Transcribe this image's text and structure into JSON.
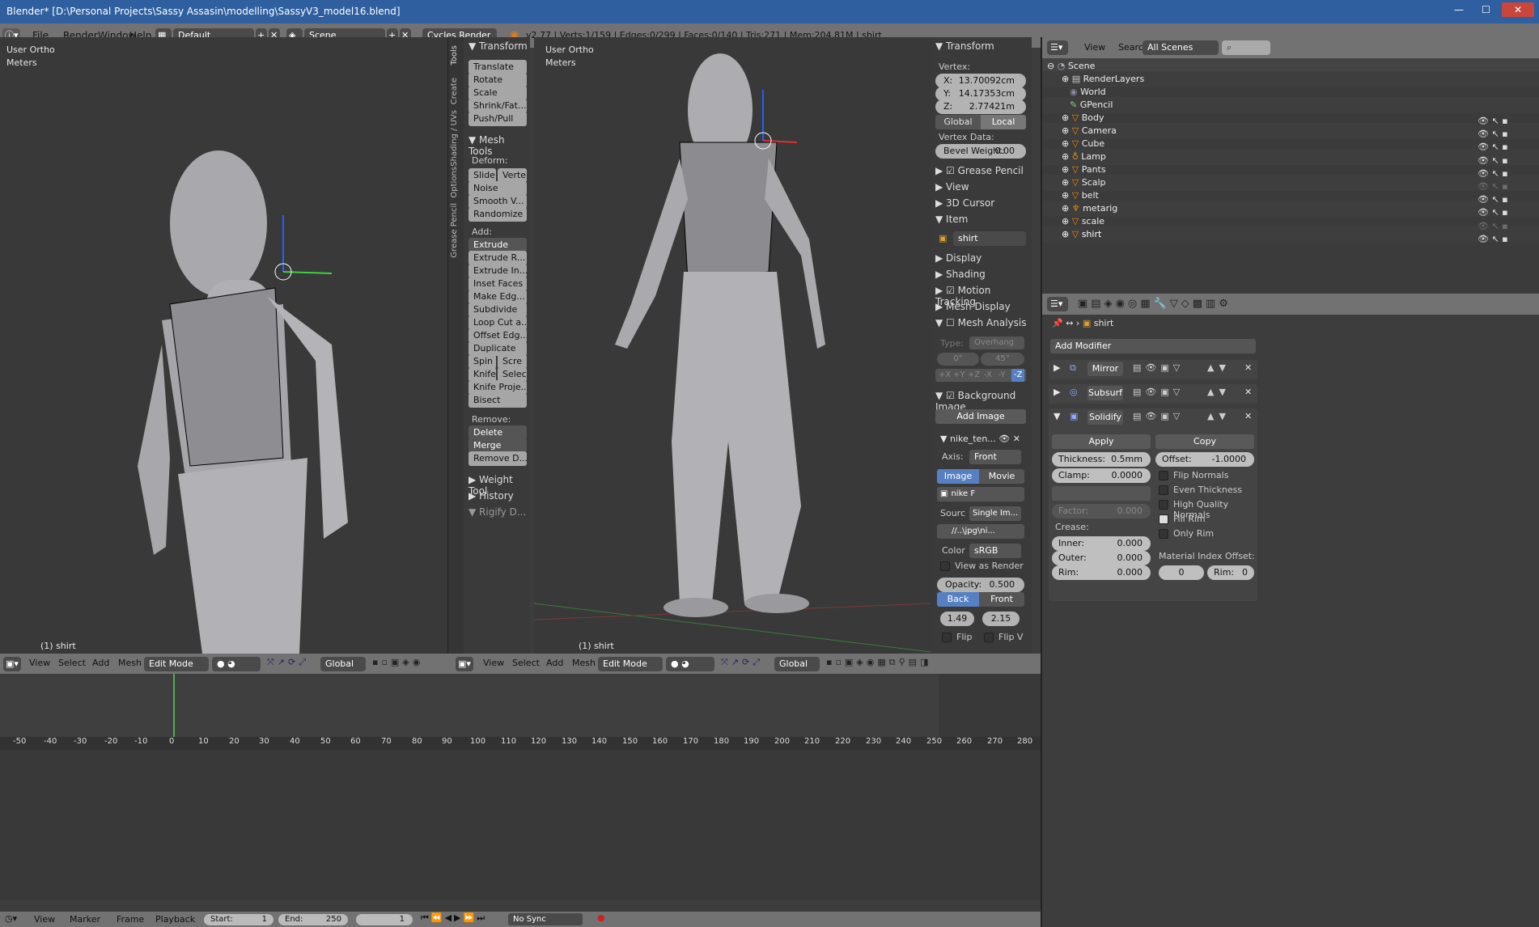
{
  "window": {
    "title": "Blender* [D:\\Personal Projects\\Sassy Assasin\\modelling\\SassyV3_model16.blend]",
    "btns": [
      "—",
      "☐",
      "✕"
    ]
  },
  "menubar": {
    "items": [
      "File",
      "Render",
      "Window",
      "Help"
    ],
    "layout": "Default",
    "scene": "Scene",
    "engine": "Cycles Render",
    "stats": "v2.77 | Verts:1/159 | Edges:0/299 | Faces:0/140 | Tris:271 | Mem:204.81M | shirt"
  },
  "viewport_left": {
    "label1": "User Ortho",
    "label2": "Meters",
    "footer": "(1) shirt"
  },
  "viewport_right": {
    "label1": "User Ortho",
    "label2": "Meters",
    "footer": "(1) shirt"
  },
  "tool_tabs": [
    "Tools",
    "Create",
    "Shading / UVs",
    "Options",
    "Grease Pencil"
  ],
  "toolshelf": {
    "transform": "Transform",
    "translate": "Translate",
    "rotate": "Rotate",
    "scale": "Scale",
    "shrink": "Shrink/Fat...",
    "push": "Push/Pull",
    "mesh_tools": "Mesh Tools",
    "deform": "Deform:",
    "slide": "Slide",
    "vertex": "Verte",
    "noise": "Noise",
    "smooth": "Smooth V...",
    "randomize": "Randomize",
    "add": "Add:",
    "extrude": "Extrude",
    "extrude_r": "Extrude R...",
    "extrude_in": "Extrude In...",
    "inset": "Inset Faces",
    "make_edge": "Make Edg...",
    "subdivide": "Subdivide",
    "loopcut": "Loop Cut a...",
    "offset_edge": "Offset Edg...",
    "duplicate": "Duplicate",
    "spin": "Spin",
    "screw": "Scre",
    "knife": "Knife",
    "select": "Selec",
    "knife_proj": "Knife Proje...",
    "bisect": "Bisect",
    "remove": "Remove:",
    "delete": "Delete",
    "merge": "Merge",
    "remove_d": "Remove D...",
    "weight": "Weight Tool",
    "history": "History",
    "rigify": "Rigify D..."
  },
  "npanel": {
    "transform": "Transform",
    "vertex": "Vertex:",
    "x": "X:",
    "xval": "13.70092cm",
    "y": "Y:",
    "yval": "14.17353cm",
    "z": "Z:",
    "zval": "2.77421m",
    "global": "Global",
    "local": "Local",
    "vertex_data": "Vertex Data:",
    "bevel": "Bevel Weight:",
    "bevel_val": "0.00",
    "grease": "Grease Pencil",
    "view": "View",
    "cursor": "3D Cursor",
    "item": "Item",
    "item_name": "shirt",
    "display": "Display",
    "shading": "Shading",
    "motion": "Motion Tracking",
    "meshdisplay": "Mesh Display",
    "analysis": "Mesh Analysis",
    "type": "Type:",
    "overhang": "Overhang",
    "deg0": "0°",
    "deg45": "45°",
    "axes": [
      "+X",
      "+Y",
      "+Z",
      "-X",
      "-Y",
      "-Z"
    ],
    "bgimage": "Background Image",
    "addimage": "Add Image",
    "imgname": "nike_ten...",
    "axis": "Axis:",
    "front": "Front",
    "image": "Image",
    "movieclip": "Movie Clip",
    "nike": "nike",
    "f": "F",
    "source": "Sourc",
    "single": "Single Im...",
    "path": "//..\\jpg\\ni...",
    "color": "Color",
    "srgb": "sRGB",
    "view_as_render": "View as Render",
    "opacity": "Opacity:",
    "opacity_val": "0.500",
    "back": "Back",
    "front2": "Front",
    "v1": "1.49",
    "v2": "2.15",
    "flip": "Flip",
    "flipv": "Flip V"
  },
  "outliner": {
    "menu": [
      "View",
      "Search"
    ],
    "filter": "All Scenes",
    "items": [
      {
        "n": "Scene",
        "d": 0
      },
      {
        "n": "RenderLayers",
        "d": 1
      },
      {
        "n": "World",
        "d": 1
      },
      {
        "n": "GPencil",
        "d": 1
      },
      {
        "n": "Body",
        "d": 1
      },
      {
        "n": "Camera",
        "d": 1
      },
      {
        "n": "Cube",
        "d": 1
      },
      {
        "n": "Lamp",
        "d": 1
      },
      {
        "n": "Pants",
        "d": 1
      },
      {
        "n": "Scalp",
        "d": 1
      },
      {
        "n": "belt",
        "d": 1
      },
      {
        "n": "metarig",
        "d": 1
      },
      {
        "n": "scale",
        "d": 1
      },
      {
        "n": "shirt",
        "d": 1
      }
    ]
  },
  "properties": {
    "object": "shirt",
    "add_modifier": "Add Modifier",
    "mods": [
      "Mirror",
      "Subsurf",
      "Solidify"
    ],
    "apply": "Apply",
    "copy": "Copy",
    "thickness": "Thickness:",
    "thickness_val": "0.5mm",
    "offset": "Offset:",
    "offset_val": "-1.0000",
    "clamp": "Clamp:",
    "clamp_val": "0.0000",
    "flip_normals": "Flip Normals",
    "even": "Even Thickness",
    "hq": "High Quality Normals",
    "factor": "Factor:",
    "factor_val": "0.000",
    "fillrim": "Fill Rim",
    "onlyrim": "Only Rim",
    "crease": "Crease:",
    "inner": "Inner:",
    "inner_val": "0.000",
    "outer": "Outer:",
    "outer_val": "0.000",
    "rim": "Rim:",
    "rim_val": "0.000",
    "matidx": "Material Index Offset:",
    "mat0": "0",
    "rim2": "Rim:",
    "rim2_val": "0"
  },
  "vp_header": {
    "menus": [
      "View",
      "Select",
      "Add",
      "Mesh"
    ],
    "mode": "Edit Mode",
    "orient": "Global"
  },
  "timeline": {
    "ticks": [
      "-50",
      "-40",
      "-30",
      "-20",
      "-10",
      "0",
      "10",
      "20",
      "30",
      "40",
      "50",
      "60",
      "70",
      "80",
      "90",
      "100",
      "110",
      "120",
      "130",
      "140",
      "150",
      "160",
      "170",
      "180",
      "190",
      "200",
      "210",
      "220",
      "230",
      "240",
      "250",
      "260",
      "270",
      "280"
    ],
    "menus": [
      "View",
      "Marker",
      "Frame",
      "Playback"
    ],
    "start": "Start:",
    "start_val": "1",
    "end": "End:",
    "end_val": "250",
    "cur": "1",
    "sync": "No Sync"
  },
  "colors": {
    "accent": "#5680c2",
    "bg": "#393939",
    "title": "#2f5f9e"
  }
}
